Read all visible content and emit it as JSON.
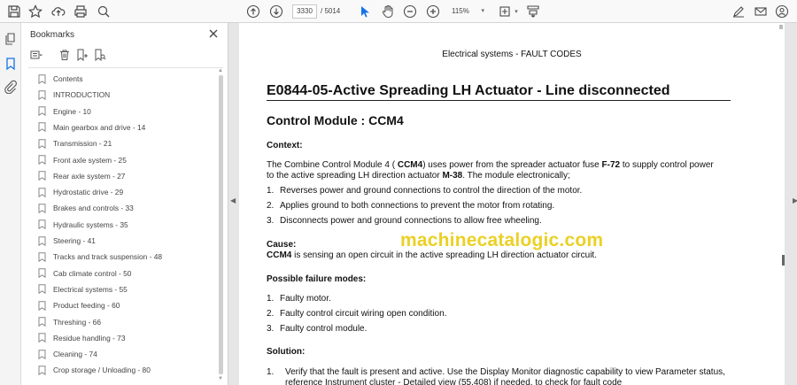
{
  "toolbar": {
    "page_current": "3330",
    "page_total": "/ 5014",
    "zoom": "115%"
  },
  "bookmarks": {
    "title": "Bookmarks",
    "items": [
      {
        "label": "Contents"
      },
      {
        "label": "INTRODUCTION"
      },
      {
        "label": "Engine - 10"
      },
      {
        "label": "Main gearbox and drive - 14"
      },
      {
        "label": "Transmission - 21"
      },
      {
        "label": "Front axle system - 25"
      },
      {
        "label": "Rear axle system - 27"
      },
      {
        "label": "Hydrostatic drive - 29"
      },
      {
        "label": "Brakes and controls - 33"
      },
      {
        "label": "Hydraulic systems - 35"
      },
      {
        "label": "Steering - 41"
      },
      {
        "label": "Tracks and track suspension - 48"
      },
      {
        "label": "Cab climate control - 50"
      },
      {
        "label": "Electrical systems - 55"
      },
      {
        "label": "Product feeding - 60"
      },
      {
        "label": "Threshing - 66"
      },
      {
        "label": "Residue handling - 73"
      },
      {
        "label": "Cleaning - 74"
      },
      {
        "label": "Crop storage / Unloading - 80"
      }
    ]
  },
  "document": {
    "header": "Electrical systems - FAULT CODES",
    "title": "E0844-05-Active Spreading LH Actuator - Line disconnected",
    "subtitle": "Control Module :  CCM4",
    "context_heading": "Context:",
    "context_line1_a": "The Combine Control Module 4 ( ",
    "context_line1_b": "CCM4",
    "context_line1_c": ") uses power from the spreader actuator fuse ",
    "context_line1_d": "F-72",
    "context_line1_e": " to supply control power",
    "context_line2_a": "to the active spreading LH direction actuator ",
    "context_line2_b": "M-38",
    "context_line2_c": ".  The module electronically;",
    "context_list": [
      {
        "num": "1.",
        "text": "Reverses power and ground connections to control the direction of the motor."
      },
      {
        "num": "2.",
        "text": "Applies ground to both connections to prevent the motor from rotating."
      },
      {
        "num": "3.",
        "text": "Disconnects power and ground connections to allow free wheeling."
      }
    ],
    "cause_heading": "Cause:",
    "cause_a": "CCM4",
    "cause_b": " is sensing an open circuit in the active spreading LH direction actuator circuit.",
    "failure_heading": "Possible failure modes:",
    "failure_list": [
      {
        "num": "1.",
        "text": "Faulty motor."
      },
      {
        "num": "2.",
        "text": "Faulty control circuit wiring open condition."
      },
      {
        "num": "3.",
        "text": "Faulty control module."
      }
    ],
    "solution_heading": "Solution:",
    "solution_num": "1.",
    "solution_line1": "Verify that the fault is present and active.  Use the Display Monitor diagnostic capability to view Parameter status,",
    "solution_line2": "reference Instrument cluster - Detailed view (55.408) if needed, to check for fault code",
    "watermark": "machinecatalogic.com"
  },
  "colors": {
    "accent": "#1473e6",
    "watermark": "#e8c800"
  }
}
